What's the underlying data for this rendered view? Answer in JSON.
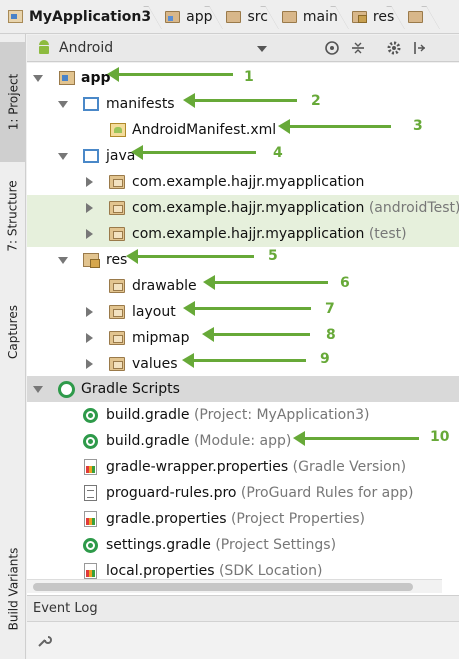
{
  "breadcrumb": [
    "MyApplication3",
    "app",
    "src",
    "main",
    "res"
  ],
  "left_strip": {
    "project": "1: Project",
    "structure": "7: Structure",
    "captures": "Captures",
    "build_variants": "Build Variants"
  },
  "panel": {
    "view_label": "Android"
  },
  "tree": [
    {
      "label": "app",
      "hint": ""
    },
    {
      "label": "manifests",
      "hint": ""
    },
    {
      "label": "AndroidManifest.xml",
      "hint": ""
    },
    {
      "label": "java",
      "hint": ""
    },
    {
      "label": "com.example.hajjr.myapplication",
      "hint": ""
    },
    {
      "label": "com.example.hajjr.myapplication",
      "hint": "(androidTest)"
    },
    {
      "label": "com.example.hajjr.myapplication",
      "hint": "(test)"
    },
    {
      "label": "res",
      "hint": ""
    },
    {
      "label": "drawable",
      "hint": ""
    },
    {
      "label": "layout",
      "hint": ""
    },
    {
      "label": "mipmap",
      "hint": ""
    },
    {
      "label": "values",
      "hint": ""
    },
    {
      "label": "Gradle Scripts",
      "hint": ""
    },
    {
      "label": "build.gradle",
      "hint": "(Project: MyApplication3)"
    },
    {
      "label": "build.gradle",
      "hint": "(Module: app)"
    },
    {
      "label": "gradle-wrapper.properties",
      "hint": "(Gradle Version)"
    },
    {
      "label": "proguard-rules.pro",
      "hint": "(ProGuard Rules for app)"
    },
    {
      "label": "gradle.properties",
      "hint": "(Project Properties)"
    },
    {
      "label": "settings.gradle",
      "hint": "(Project Settings)"
    },
    {
      "label": "local.properties",
      "hint": "(SDK Location)"
    }
  ],
  "annotations": [
    "1",
    "2",
    "3",
    "4",
    "5",
    "6",
    "7",
    "8",
    "9",
    "10"
  ],
  "bottom": {
    "event_log": "Event Log"
  },
  "colors": {
    "annotation_green": "#67a938"
  }
}
